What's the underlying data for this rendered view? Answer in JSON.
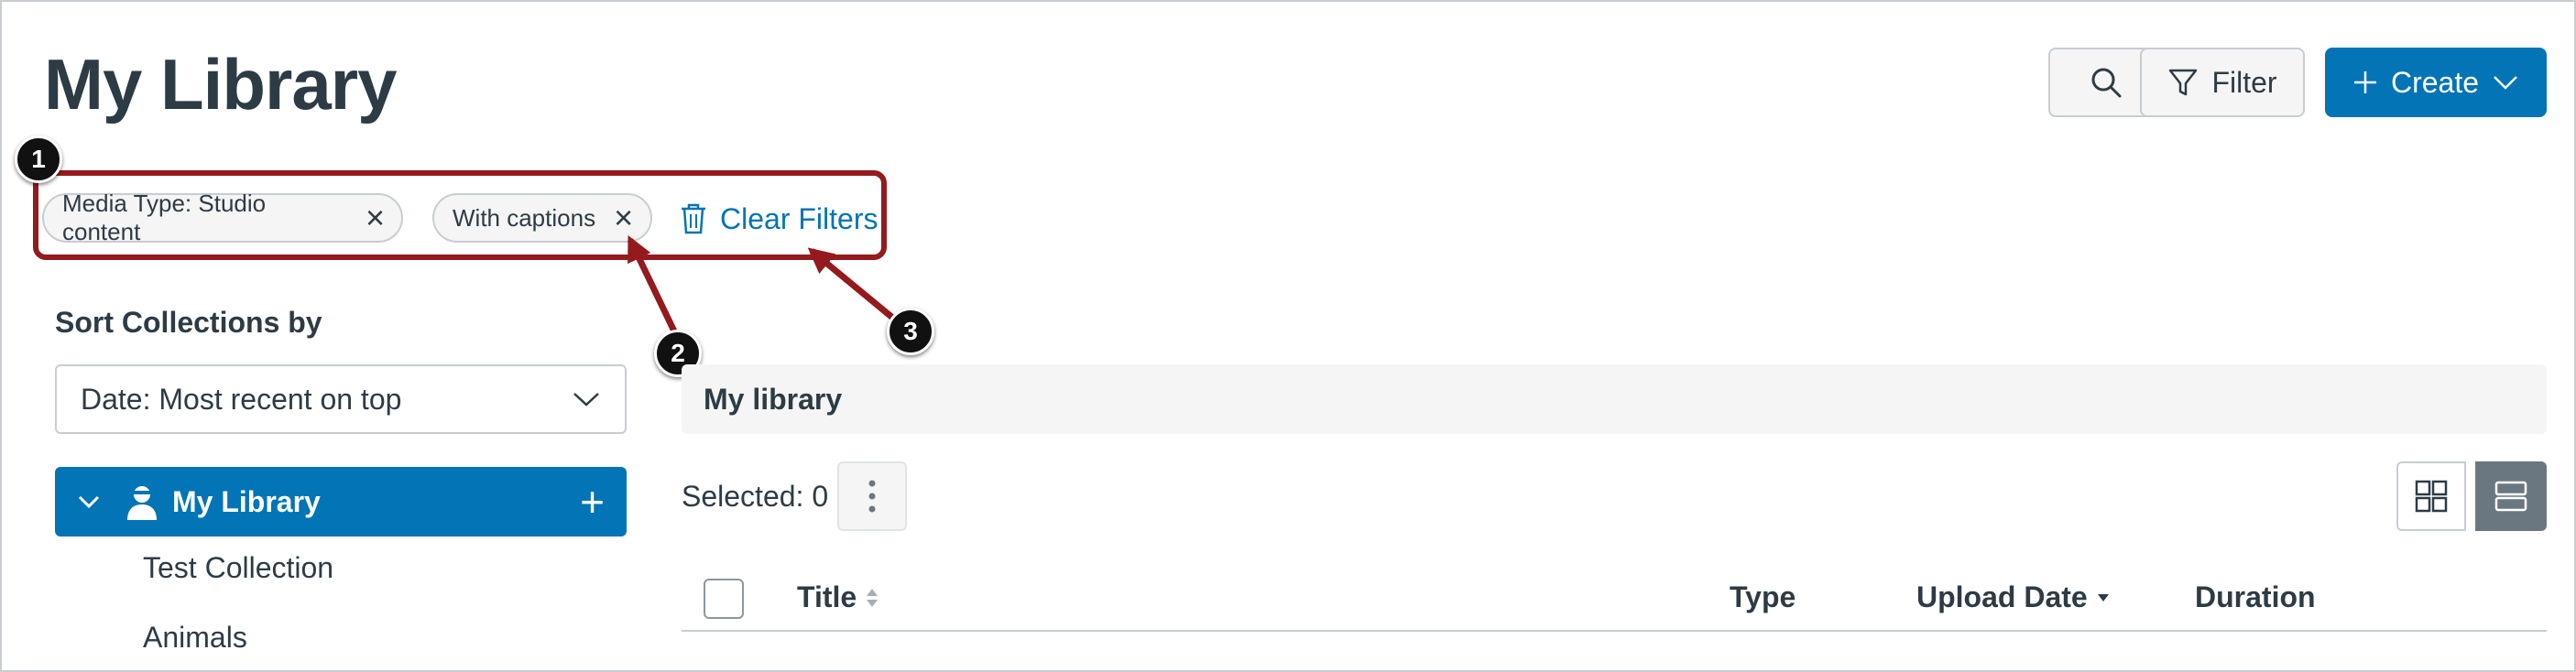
{
  "header": {
    "title": "My Library",
    "filter_label": "Filter",
    "create_label": "Create"
  },
  "filters": {
    "tags": [
      "Media Type: Studio content",
      "With captions"
    ],
    "clear_label": "Clear Filters"
  },
  "callouts": [
    "1",
    "2",
    "3"
  ],
  "sidebar": {
    "sort_label": "Sort Collections by",
    "sort_value": "Date: Most recent on top",
    "active_item": "My Library",
    "items": [
      "Test Collection",
      "Animals"
    ]
  },
  "main": {
    "section_title": "My library",
    "selected_text": "Selected: 0",
    "columns": [
      "Title",
      "Type",
      "Upload Date",
      "Duration"
    ]
  },
  "colors": {
    "accent": "#0374b5",
    "callout": "#951a1d",
    "text": "#2d3b45"
  }
}
